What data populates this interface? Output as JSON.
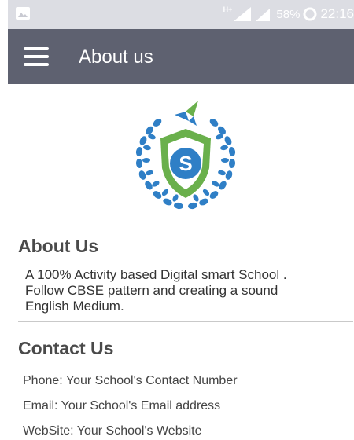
{
  "status_bar": {
    "network": "H+",
    "battery": "58%",
    "time": "22:16"
  },
  "app_bar": {
    "title": "About us"
  },
  "about": {
    "heading": "About Us",
    "lines": [
      "A 100% Activity based Digital smart School .",
      "Follow CBSE pattern and creating a sound",
      "English Medium."
    ]
  },
  "contact": {
    "heading": "Contact Us",
    "phone": "Phone: Your School's Contact Number",
    "email": "Email: Your School's Email address",
    "website": "WebSite: Your School's Website"
  },
  "colors": {
    "appbar": "#5e6170",
    "statusbar": "#dcdde3",
    "logo_blue": "#2f7fc6",
    "logo_green": "#6ab04c"
  }
}
